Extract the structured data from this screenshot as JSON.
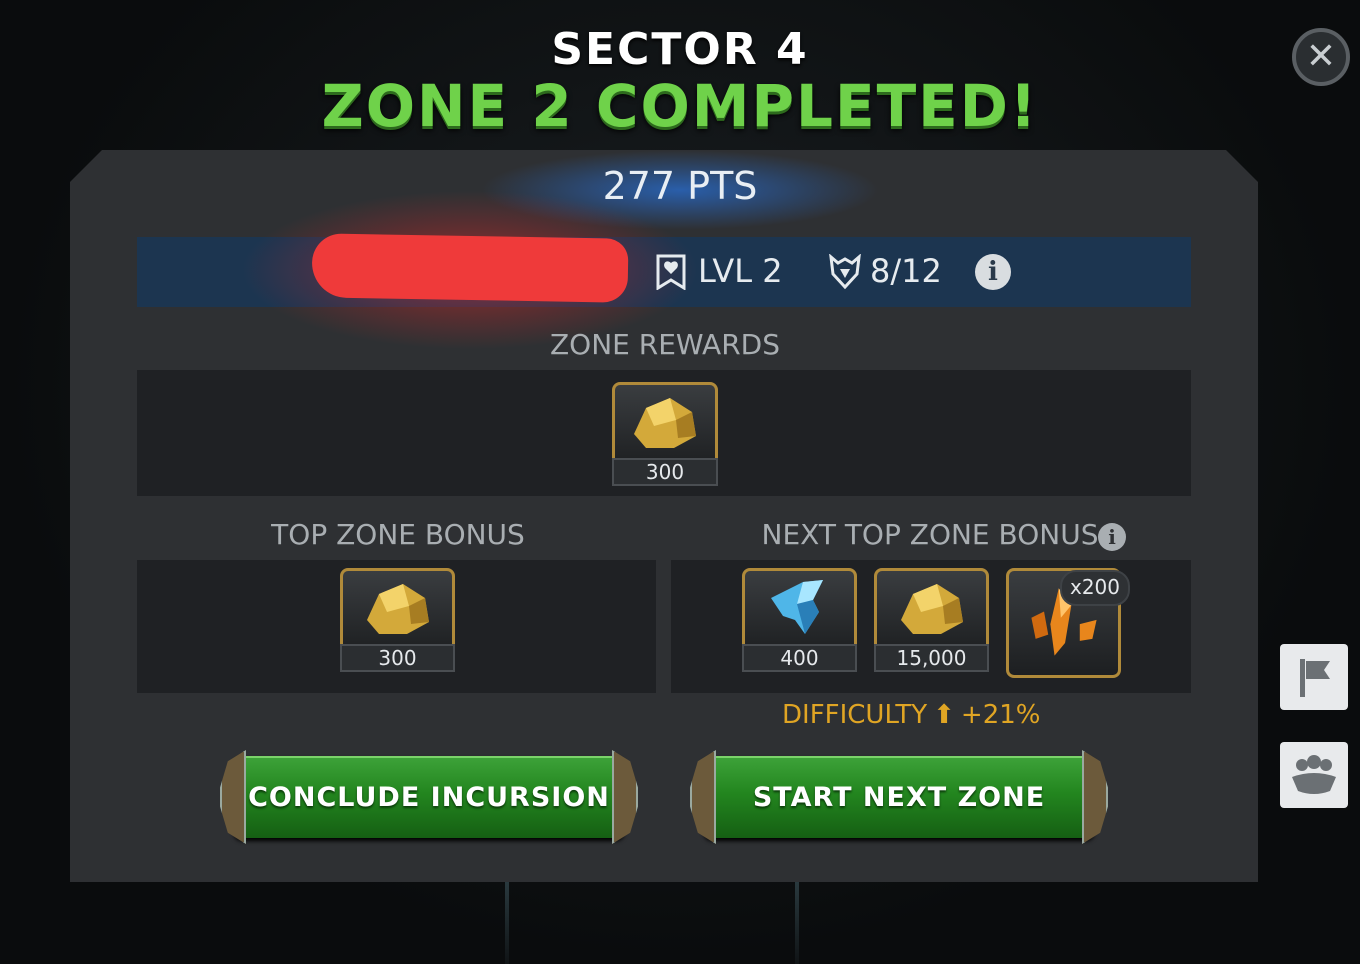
{
  "header": {
    "sector": "SECTOR 4",
    "title": "ZONE 2 COMPLETED!"
  },
  "close_icon": "close-icon",
  "summary": {
    "points": "277 PTS",
    "level": "LVL 2",
    "progress": "8/12"
  },
  "zone_rewards": {
    "label": "ZONE REWARDS",
    "items": [
      {
        "icon": "gold-icon",
        "qty": "300"
      }
    ]
  },
  "top_zone_bonus": {
    "label": "TOP ZONE BONUS",
    "items": [
      {
        "icon": "gold-icon",
        "qty": "300"
      }
    ]
  },
  "next_top_zone_bonus": {
    "label": "NEXT TOP ZONE BONUS",
    "items": [
      {
        "icon": "crystal-shard-icon",
        "qty": "400"
      },
      {
        "icon": "gold-icon",
        "qty": "15,000"
      },
      {
        "icon": "orange-shard-icon",
        "badge": "x200"
      }
    ]
  },
  "difficulty": {
    "label": "DIFFICULTY",
    "value": "+21%"
  },
  "buttons": {
    "conclude": "CONCLUDE INCURSION",
    "next": "START NEXT ZONE"
  },
  "side": {
    "flag_icon": "flag-icon",
    "alliance_icon": "alliance-icon"
  },
  "colors": {
    "title_green": "#6fd24a",
    "button_green": "#23861f",
    "difficulty_orange": "#e0a524",
    "stats_bar": "#1c3550",
    "panel": "#2e3033"
  }
}
